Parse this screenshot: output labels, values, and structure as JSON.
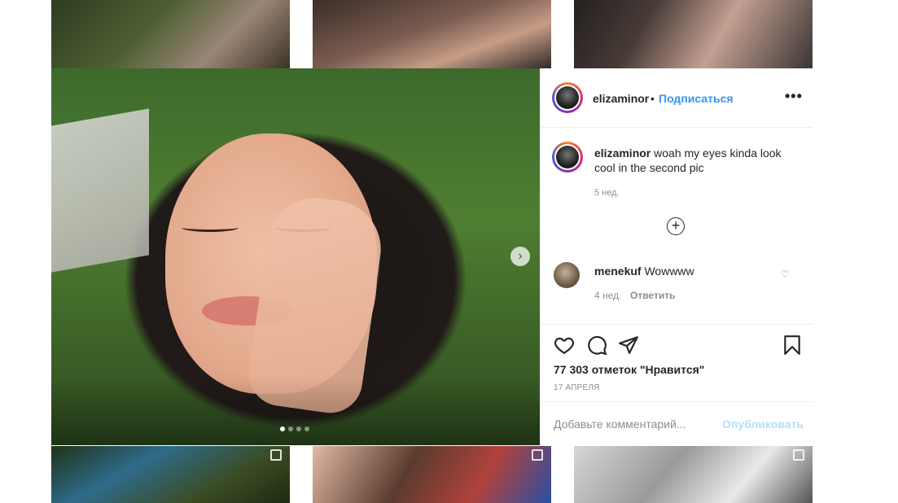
{
  "post": {
    "username": "elizaminor",
    "separator": "•",
    "follow_label": "Подписаться",
    "more_label": "•••",
    "caption_username": "elizaminor",
    "caption_text": "woah my eyes kinda look cool in the second pic",
    "caption_time": "5 нед.",
    "load_more_label": "+",
    "comments": [
      {
        "username": "menekuf",
        "text": "Wowwww",
        "time": "4 нед.",
        "reply_label": "Ответить",
        "like_label": "♡"
      }
    ],
    "likes_text": "77 303 отметок \"Нравится\"",
    "date": "17 апреля",
    "add_comment_placeholder": "Добавьте комментарий...",
    "publish_label": "Опубликовать"
  },
  "carousel": {
    "slide_count": 4,
    "active_index": 0,
    "next_label": "›"
  },
  "nav": {
    "prev_label": "‹",
    "next_label": "›"
  },
  "icons": {
    "like": "heart-icon",
    "comment": "comment-bubble-icon",
    "share": "paper-plane-icon",
    "save": "bookmark-icon",
    "multi": "multiple-images-icon"
  },
  "colors": {
    "accent_blue": "#3897f0",
    "publish_disabled": "#b2dffc",
    "text": "#262626",
    "secondary_text": "#8e8e8e"
  }
}
